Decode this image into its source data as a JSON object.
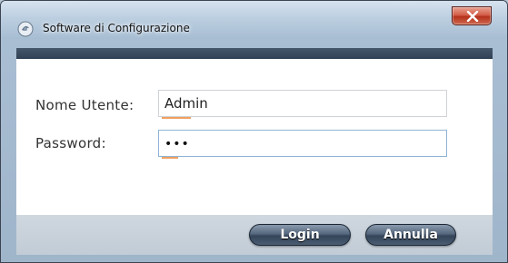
{
  "window": {
    "title": "Software di Configurazione",
    "icon": "app-logo-icon",
    "close_icon": "close-icon"
  },
  "form": {
    "username_label": "Nome Utente:",
    "username_value": "Admin",
    "password_label": "Password:",
    "password_value": "•••"
  },
  "buttons": {
    "login_label": "Login",
    "cancel_label": "Annulla"
  },
  "colors": {
    "close_button": "#d35e47",
    "header_strip": "#3a4b5f",
    "field_accent": "#f0a060",
    "button_bg": "#4b5d72"
  }
}
